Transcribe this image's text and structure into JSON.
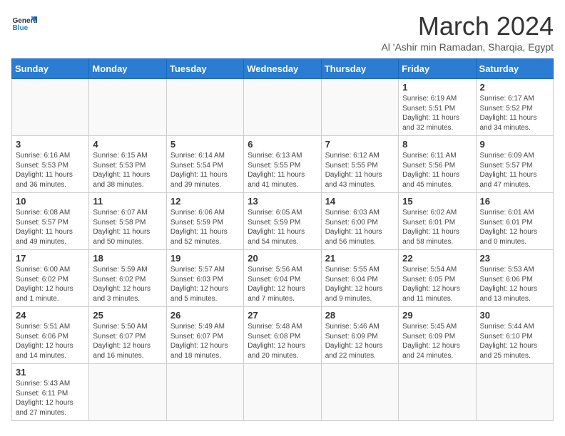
{
  "logo": {
    "text_general": "General",
    "text_blue": "Blue"
  },
  "calendar": {
    "title": "March 2024",
    "subtitle": "Al 'Ashir min Ramadan, Sharqia, Egypt",
    "days_of_week": [
      "Sunday",
      "Monday",
      "Tuesday",
      "Wednesday",
      "Thursday",
      "Friday",
      "Saturday"
    ],
    "weeks": [
      [
        {
          "day": "",
          "info": ""
        },
        {
          "day": "",
          "info": ""
        },
        {
          "day": "",
          "info": ""
        },
        {
          "day": "",
          "info": ""
        },
        {
          "day": "",
          "info": ""
        },
        {
          "day": "1",
          "info": "Sunrise: 6:19 AM\nSunset: 5:51 PM\nDaylight: 11 hours and 32 minutes."
        },
        {
          "day": "2",
          "info": "Sunrise: 6:17 AM\nSunset: 5:52 PM\nDaylight: 11 hours and 34 minutes."
        }
      ],
      [
        {
          "day": "3",
          "info": "Sunrise: 6:16 AM\nSunset: 5:53 PM\nDaylight: 11 hours and 36 minutes."
        },
        {
          "day": "4",
          "info": "Sunrise: 6:15 AM\nSunset: 5:53 PM\nDaylight: 11 hours and 38 minutes."
        },
        {
          "day": "5",
          "info": "Sunrise: 6:14 AM\nSunset: 5:54 PM\nDaylight: 11 hours and 39 minutes."
        },
        {
          "day": "6",
          "info": "Sunrise: 6:13 AM\nSunset: 5:55 PM\nDaylight: 11 hours and 41 minutes."
        },
        {
          "day": "7",
          "info": "Sunrise: 6:12 AM\nSunset: 5:55 PM\nDaylight: 11 hours and 43 minutes."
        },
        {
          "day": "8",
          "info": "Sunrise: 6:11 AM\nSunset: 5:56 PM\nDaylight: 11 hours and 45 minutes."
        },
        {
          "day": "9",
          "info": "Sunrise: 6:09 AM\nSunset: 5:57 PM\nDaylight: 11 hours and 47 minutes."
        }
      ],
      [
        {
          "day": "10",
          "info": "Sunrise: 6:08 AM\nSunset: 5:57 PM\nDaylight: 11 hours and 49 minutes."
        },
        {
          "day": "11",
          "info": "Sunrise: 6:07 AM\nSunset: 5:58 PM\nDaylight: 11 hours and 50 minutes."
        },
        {
          "day": "12",
          "info": "Sunrise: 6:06 AM\nSunset: 5:59 PM\nDaylight: 11 hours and 52 minutes."
        },
        {
          "day": "13",
          "info": "Sunrise: 6:05 AM\nSunset: 5:59 PM\nDaylight: 11 hours and 54 minutes."
        },
        {
          "day": "14",
          "info": "Sunrise: 6:03 AM\nSunset: 6:00 PM\nDaylight: 11 hours and 56 minutes."
        },
        {
          "day": "15",
          "info": "Sunrise: 6:02 AM\nSunset: 6:01 PM\nDaylight: 11 hours and 58 minutes."
        },
        {
          "day": "16",
          "info": "Sunrise: 6:01 AM\nSunset: 6:01 PM\nDaylight: 12 hours and 0 minutes."
        }
      ],
      [
        {
          "day": "17",
          "info": "Sunrise: 6:00 AM\nSunset: 6:02 PM\nDaylight: 12 hours and 1 minute."
        },
        {
          "day": "18",
          "info": "Sunrise: 5:59 AM\nSunset: 6:02 PM\nDaylight: 12 hours and 3 minutes."
        },
        {
          "day": "19",
          "info": "Sunrise: 5:57 AM\nSunset: 6:03 PM\nDaylight: 12 hours and 5 minutes."
        },
        {
          "day": "20",
          "info": "Sunrise: 5:56 AM\nSunset: 6:04 PM\nDaylight: 12 hours and 7 minutes."
        },
        {
          "day": "21",
          "info": "Sunrise: 5:55 AM\nSunset: 6:04 PM\nDaylight: 12 hours and 9 minutes."
        },
        {
          "day": "22",
          "info": "Sunrise: 5:54 AM\nSunset: 6:05 PM\nDaylight: 12 hours and 11 minutes."
        },
        {
          "day": "23",
          "info": "Sunrise: 5:53 AM\nSunset: 6:06 PM\nDaylight: 12 hours and 13 minutes."
        }
      ],
      [
        {
          "day": "24",
          "info": "Sunrise: 5:51 AM\nSunset: 6:06 PM\nDaylight: 12 hours and 14 minutes."
        },
        {
          "day": "25",
          "info": "Sunrise: 5:50 AM\nSunset: 6:07 PM\nDaylight: 12 hours and 16 minutes."
        },
        {
          "day": "26",
          "info": "Sunrise: 5:49 AM\nSunset: 6:07 PM\nDaylight: 12 hours and 18 minutes."
        },
        {
          "day": "27",
          "info": "Sunrise: 5:48 AM\nSunset: 6:08 PM\nDaylight: 12 hours and 20 minutes."
        },
        {
          "day": "28",
          "info": "Sunrise: 5:46 AM\nSunset: 6:09 PM\nDaylight: 12 hours and 22 minutes."
        },
        {
          "day": "29",
          "info": "Sunrise: 5:45 AM\nSunset: 6:09 PM\nDaylight: 12 hours and 24 minutes."
        },
        {
          "day": "30",
          "info": "Sunrise: 5:44 AM\nSunset: 6:10 PM\nDaylight: 12 hours and 25 minutes."
        }
      ],
      [
        {
          "day": "31",
          "info": "Sunrise: 5:43 AM\nSunset: 6:11 PM\nDaylight: 12 hours and 27 minutes."
        },
        {
          "day": "",
          "info": ""
        },
        {
          "day": "",
          "info": ""
        },
        {
          "day": "",
          "info": ""
        },
        {
          "day": "",
          "info": ""
        },
        {
          "day": "",
          "info": ""
        },
        {
          "day": "",
          "info": ""
        }
      ]
    ]
  }
}
